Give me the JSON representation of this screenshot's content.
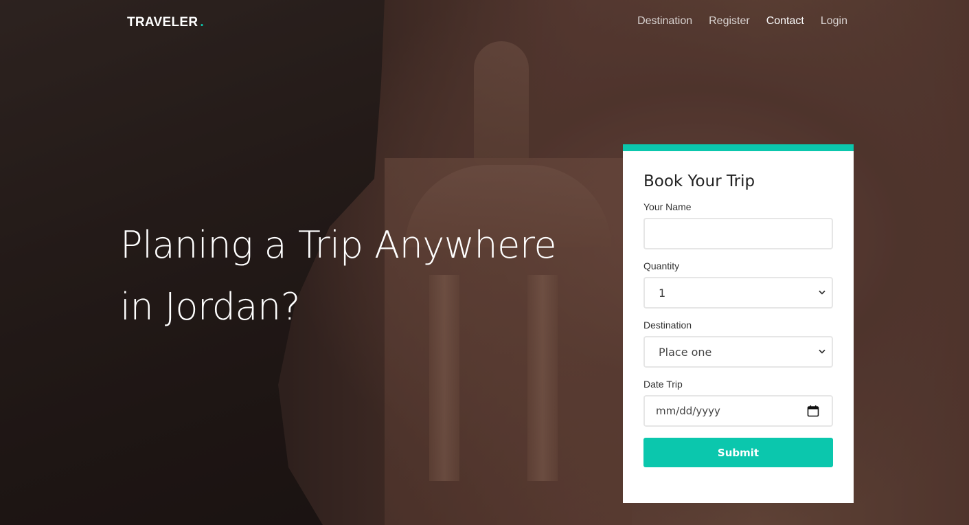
{
  "navbar": {
    "brand": "TRAVELER",
    "brand_dot": ".",
    "links": [
      "Destination",
      "Register",
      "Contact",
      "Login"
    ],
    "active_link": "Contact"
  },
  "hero": {
    "line1": "Planing a Trip Anywhere",
    "line2": "in Jordan?"
  },
  "form": {
    "title": "Book Your Trip",
    "name_label": "Your Name",
    "name_value": "",
    "quantity_label": "Quantity",
    "quantity_value": "1",
    "destination_label": "Destination",
    "destination_value": "Place one",
    "date_label": "Date Trip",
    "date_placeholder": "mm/dd/yyyy",
    "submit_label": "Submit"
  },
  "colors": {
    "accent": "#0bc7ad",
    "card_bg": "#ffffff",
    "text_dark": "#222222"
  },
  "icons": {
    "select_arrow": "chevron-down-icon",
    "date_picker": "calendar-icon"
  }
}
